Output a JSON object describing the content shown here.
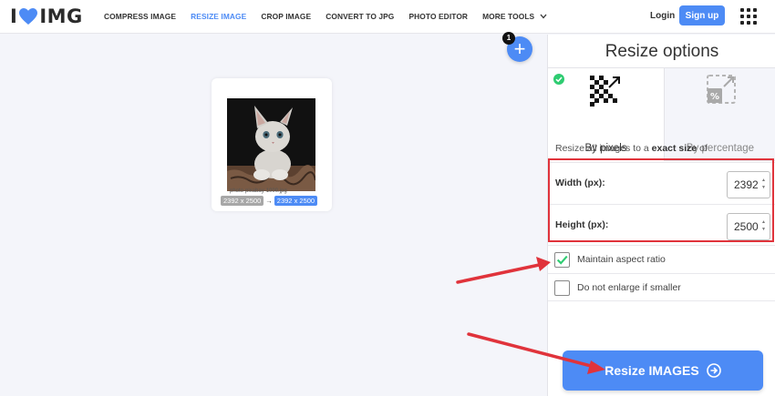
{
  "header": {
    "logo_left": "I",
    "logo_right": "IMG",
    "nav": [
      "COMPRESS IMAGE",
      "RESIZE IMAGE",
      "CROP IMAGE",
      "CONVERT TO JPG",
      "PHOTO EDITOR",
      "MORE TOOLS"
    ],
    "login": "Login",
    "signup": "Sign up"
  },
  "workspace": {
    "file_name": "photo-pixabay-1000.jpg",
    "original_size": "2392 x 2500",
    "new_size": "2392 x 2500",
    "file_count": "1",
    "add_symbol": "+"
  },
  "panel": {
    "title": "Resize options",
    "tab_pixels": "By pixels",
    "tab_percentage": "By percentage",
    "description_prefix": "Resize all images to a ",
    "description_bold": "exact size",
    "description_suffix": " of",
    "width_label": "Width (px):",
    "width_value": "2392",
    "height_label": "Height (px):",
    "height_value": "2500",
    "maintain_aspect": "Maintain aspect ratio",
    "maintain_aspect_checked": true,
    "no_enlarge": "Do not enlarge if smaller",
    "no_enlarge_checked": false,
    "submit": "Resize IMAGES"
  },
  "colors": {
    "accent": "#4d8bf5",
    "highlight": "#e0333b",
    "check": "#2ecc71"
  }
}
